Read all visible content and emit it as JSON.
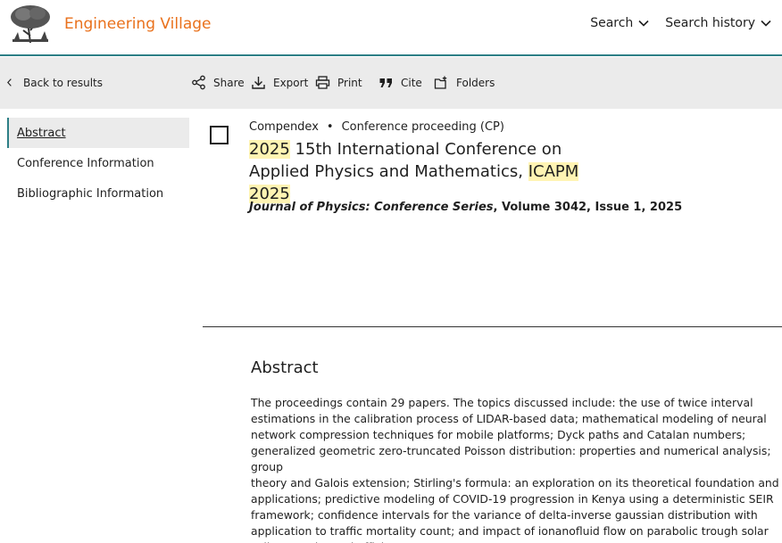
{
  "header": {
    "brand": "Engineering Village",
    "brand_color": "#e9711c",
    "logo_icon": "elsevier-tree-icon",
    "nav": [
      {
        "label": "Search",
        "icon": "chevron-down-icon"
      },
      {
        "label": "Search history",
        "icon": "chevron-down-icon"
      }
    ]
  },
  "toolbar": {
    "back_label": "Back to results",
    "share_label": "Share",
    "export_label": "Export",
    "print_label": "Print",
    "cite_label": "Cite",
    "folders_label": "Folders"
  },
  "sidebar": {
    "items": [
      {
        "label": "Abstract",
        "active": true
      },
      {
        "label": "Conference Information",
        "active": false
      },
      {
        "label": "Bibliographic Information",
        "active": false
      }
    ]
  },
  "record": {
    "database": "Compendex",
    "separator": "•",
    "doc_type": "Conference proceeding (CP)",
    "title": {
      "year1": "2025",
      "part1": " 15th International Conference on Applied Physics and Mathematics, ",
      "acronym": "ICAPM",
      "space": " ",
      "year2": "2025"
    },
    "journal": "Journal of Physics: Conference Series",
    "volume_issue": ", Volume 3042, Issue 1, 2025"
  },
  "abstract": {
    "heading": "Abstract",
    "text": "The proceedings contain 29 papers. The topics discussed include: the use of twice interval\nestimations in the calibration process of LIDAR-based data; mathematical modeling of neural\nnetwork compression techniques for mobile platforms; Dyck paths and Catalan numbers;\ngeneralized geometric zero-truncated Poisson distribution: properties and numerical analysis; group\ntheory and Galois extension; Stirling's formula: an exploration on its theoretical foundation and\napplications; predictive modeling of COVID-19 progression in Kenya using a deterministic SEIR\nframework; confidence intervals for the variance of delta-inverse gaussian distribution with\napplication to traffic mortality count; and impact of ionanofluid flow on parabolic trough solar\ncollector's thermal efficiency."
  },
  "colors": {
    "accent": "#2d7f86",
    "highlight": "#fff4b3",
    "toolbar_bg": "#ebebeb"
  }
}
